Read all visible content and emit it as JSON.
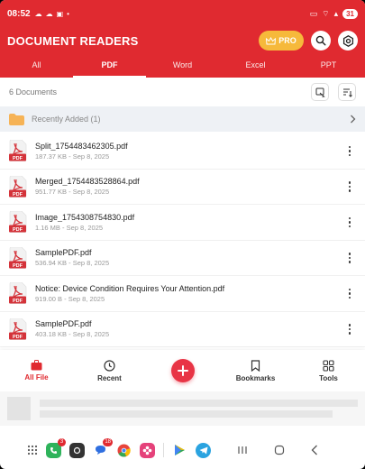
{
  "status_bar": {
    "time": "08:52",
    "battery": "31"
  },
  "header": {
    "title": "DOCUMENT READERS",
    "pro_label": "PRO"
  },
  "tabs": [
    {
      "label": "All",
      "active": false
    },
    {
      "label": "PDF",
      "active": true
    },
    {
      "label": "Word",
      "active": false
    },
    {
      "label": "Excel",
      "active": false
    },
    {
      "label": "PPT",
      "active": false
    }
  ],
  "document_count": "6 Documents",
  "recently_added": "Recently Added (1)",
  "files": [
    {
      "name": "Split_1754483462305.pdf",
      "meta": "187.37 KB - Sep 8, 2025"
    },
    {
      "name": "Merged_1754483528864.pdf",
      "meta": "951.77 KB - Sep 8, 2025"
    },
    {
      "name": "Image_1754308754830.pdf",
      "meta": "1.16 MB - Sep 8, 2025"
    },
    {
      "name": "SamplePDF.pdf",
      "meta": "536.94 KB - Sep 8, 2025"
    },
    {
      "name": "Notice: Device Condition Requires Your Attention.pdf",
      "meta": "919.00 B - Sep 8, 2025"
    },
    {
      "name": "SamplePDF.pdf",
      "meta": "403.18 KB - Sep 8, 2025"
    }
  ],
  "pdf_badge": "PDF",
  "bottom_nav": {
    "all_file": "All File",
    "recent": "Recent",
    "bookmarks": "Bookmarks",
    "tools": "Tools"
  },
  "dock_badges": {
    "phone": "3",
    "messages": "18"
  },
  "colors": {
    "primary": "#e02a30",
    "pro": "#f6b93b",
    "fab": "#e83445",
    "folder": "#f6b356"
  }
}
